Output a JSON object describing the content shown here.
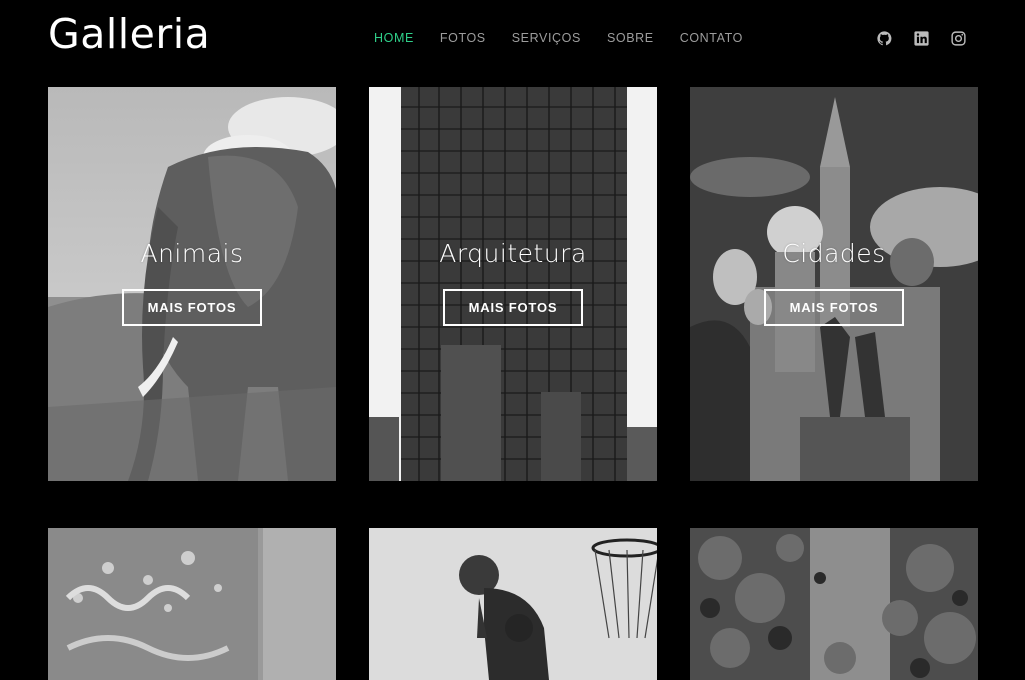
{
  "brand": {
    "logo": "Galleria"
  },
  "nav": [
    {
      "label": "HOME",
      "active": true
    },
    {
      "label": "FOTOS"
    },
    {
      "label": "SERVIÇOS"
    },
    {
      "label": "SOBRE"
    },
    {
      "label": "CONTATO"
    }
  ],
  "social": [
    "github-icon",
    "linkedin-icon",
    "instagram-icon"
  ],
  "colors": {
    "accent": "#2fd08a",
    "nav": "#9d9d9d",
    "background": "#000000"
  },
  "gallery": [
    {
      "title": "Animais",
      "button": "MAIS FOTOS"
    },
    {
      "title": "Arquitetura",
      "button": "MAIS FOTOS"
    },
    {
      "title": "Cidades",
      "button": "MAIS FOTOS"
    },
    {
      "title": "",
      "button": ""
    },
    {
      "title": "",
      "button": ""
    },
    {
      "title": "",
      "button": ""
    }
  ]
}
